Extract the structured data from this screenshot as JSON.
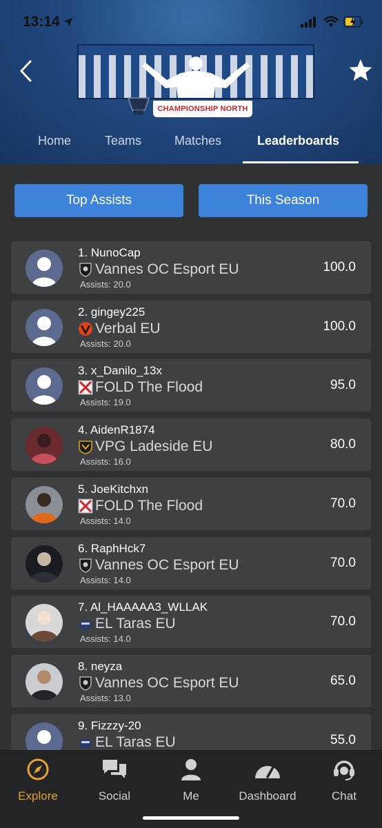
{
  "status": {
    "time": "13:14"
  },
  "header": {
    "league_subtitle": "CHAMPIONSHIP NORTH",
    "tabs": [
      "Home",
      "Teams",
      "Matches",
      "Leaderboards"
    ],
    "active_tab": "Leaderboards"
  },
  "filters": {
    "stat": "Top Assists",
    "period": "This Season"
  },
  "leaderboard": [
    {
      "rank_name": "1. NunoCap",
      "team": "Vannes OC Esport EU",
      "assists": "Assists: 20.0",
      "score": "100.0",
      "team_icon": "vannes-crest-icon",
      "avatar": "placeholder"
    },
    {
      "rank_name": "2. gingey225",
      "team": "Verbal EU",
      "assists": "Assists: 20.0",
      "score": "100.0",
      "team_icon": "verbal-crest-icon",
      "avatar": "placeholder"
    },
    {
      "rank_name": "3. x_Danilo_13x",
      "team": "FOLD The Flood",
      "assists": "Assists: 19.0",
      "score": "95.0",
      "team_icon": "broken-image-icon",
      "avatar": "placeholder"
    },
    {
      "rank_name": "4. AidenR1874",
      "team": "VPG Ladeside EU",
      "assists": "Assists: 16.0",
      "score": "80.0",
      "team_icon": "ladeside-crest-icon",
      "avatar": "photo"
    },
    {
      "rank_name": "5. JoeKitchxn",
      "team": "FOLD The Flood",
      "assists": "Assists: 14.0",
      "score": "70.0",
      "team_icon": "broken-image-icon",
      "avatar": "photo"
    },
    {
      "rank_name": "6. RaphHck7",
      "team": "Vannes OC Esport EU",
      "assists": "Assists: 14.0",
      "score": "70.0",
      "team_icon": "vannes-crest-icon",
      "avatar": "photo"
    },
    {
      "rank_name": "7. Al_HAAAAA3_WLLAK",
      "team": "EL Taras EU",
      "assists": "Assists: 14.0",
      "score": "70.0",
      "team_icon": "eltaras-crest-icon",
      "avatar": "photo"
    },
    {
      "rank_name": "8. neyza",
      "team": "Vannes OC Esport EU",
      "assists": "Assists: 13.0",
      "score": "65.0",
      "team_icon": "vannes-crest-icon",
      "avatar": "photo"
    },
    {
      "rank_name": "9. Fizzzy-20",
      "team": "EL Taras EU",
      "assists": "",
      "score": "55.0",
      "team_icon": "eltaras-crest-icon",
      "avatar": "placeholder"
    }
  ],
  "bottom_nav": [
    {
      "label": "Explore",
      "icon": "compass-icon",
      "active": true
    },
    {
      "label": "Social",
      "icon": "chat-bubbles-icon",
      "active": false
    },
    {
      "label": "Me",
      "icon": "person-icon",
      "active": false
    },
    {
      "label": "Dashboard",
      "icon": "gauge-icon",
      "active": false
    },
    {
      "label": "Chat",
      "icon": "headset-icon",
      "active": false
    }
  ],
  "colors": {
    "accent_blue": "#3c82d8",
    "active_nav": "#e8a134",
    "card_bg": "#3e4041",
    "page_bg": "#2f3132"
  }
}
